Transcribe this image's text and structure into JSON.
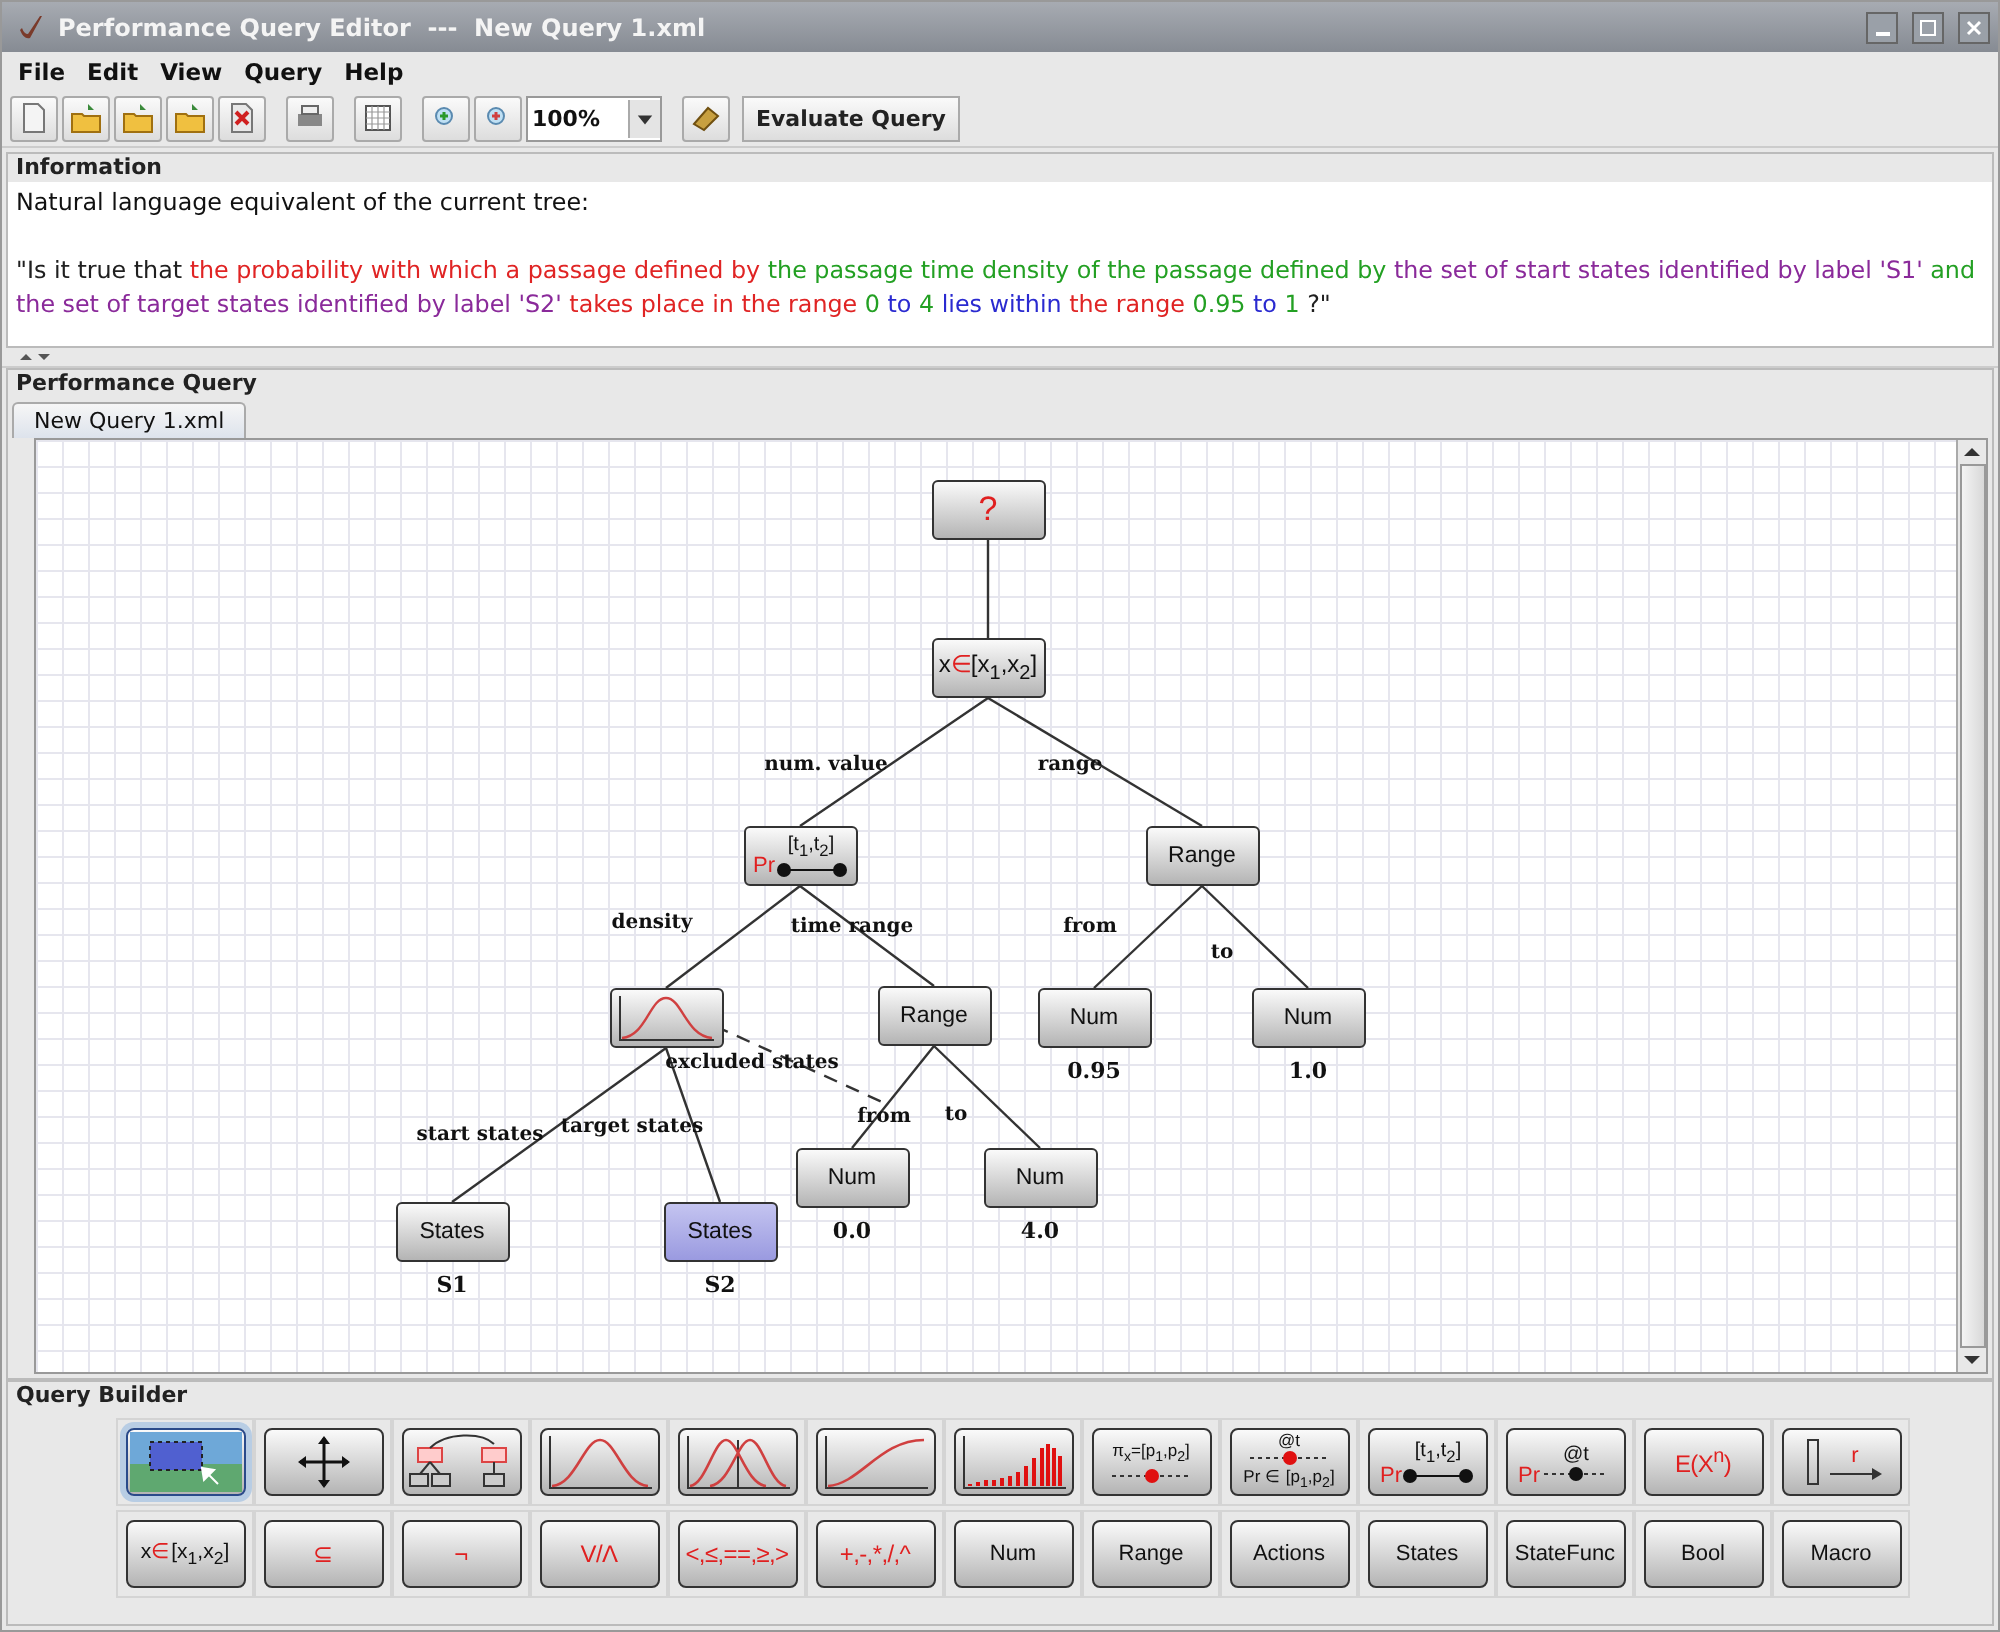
{
  "window": {
    "title": "Performance Query Editor  ---  New Query 1.xml"
  },
  "menu": [
    {
      "label": "File"
    },
    {
      "label": "Edit"
    },
    {
      "label": "View"
    },
    {
      "label": "Query"
    },
    {
      "label": "Help"
    }
  ],
  "toolbar": {
    "zoom": "100%",
    "evaluate": "Evaluate Query"
  },
  "information": {
    "title": "Information",
    "intro": "Natural language equivalent of the current tree:",
    "sentence": [
      {
        "text": "\"Is it true that ",
        "color": "#202020"
      },
      {
        "text": "the probability with which a passage defined by ",
        "color": "#e02424"
      },
      {
        "text": "the passage time density of the passage defined by ",
        "color": "#23a023"
      },
      {
        "text": "the set of start states identified by label 'S1' ",
        "color": "#8a2a9a"
      },
      {
        "text": "and ",
        "color": "#23a023"
      },
      {
        "text": "the set of target states identified by label 'S2' ",
        "color": "#8a2a9a"
      },
      {
        "text": "takes place in the range ",
        "color": "#e02424"
      },
      {
        "text": "0 ",
        "color": "#23a023"
      },
      {
        "text": "to ",
        "color": "#2a2ad0"
      },
      {
        "text": "4 ",
        "color": "#23a023"
      },
      {
        "text": "lies within ",
        "color": "#2a2ad0"
      },
      {
        "text": "the range ",
        "color": "#e02424"
      },
      {
        "text": "0.95 ",
        "color": "#23a023"
      },
      {
        "text": "to ",
        "color": "#2a2ad0"
      },
      {
        "text": "1 ",
        "color": "#23a023"
      },
      {
        "text": "?\"",
        "color": "#202020"
      }
    ]
  },
  "performance_query": {
    "title": "Performance Query",
    "tabs": [
      {
        "label": "New Query 1.xml",
        "selected": true
      }
    ],
    "tree": {
      "kind": "unknown",
      "label": "?",
      "selected": false,
      "children": [
        {
          "kind": "interval",
          "var": "x",
          "op": "∈",
          "range": "[x$_{1}$,x$_{2}$]",
          "selected": false,
          "children": [
            {
              "kind": "passage",
              "edge_label": "num. value",
              "prefix": "Pr",
              "label": "[t$_{1}$,t$_{2}$]",
              "selected": false,
              "children": [
                {
                  "kind": "density",
                  "edge_label": "density",
                  "excluded_label": "excluded states",
                  "selected": false,
                  "children": [
                    {
                      "kind": "plain",
                      "edge_label": "start states",
                      "label": "States",
                      "value": "S1",
                      "selected": false
                    },
                    {
                      "kind": "plain",
                      "edge_label": "target states",
                      "label": "States",
                      "value": "S2",
                      "selected": true
                    }
                  ]
                },
                {
                  "kind": "plain",
                  "edge_label": "time range",
                  "label": "Range",
                  "selected": false,
                  "children": [
                    {
                      "kind": "plain",
                      "edge_label": "from",
                      "label": "Num",
                      "value": "0.0",
                      "selected": false
                    },
                    {
                      "kind": "plain",
                      "edge_label": "to",
                      "label": "Num",
                      "value": "4.0",
                      "selected": false
                    }
                  ]
                }
              ]
            },
            {
              "kind": "plain",
              "edge_label": "range",
              "label": "Range",
              "selected": false,
              "children": [
                {
                  "kind": "plain",
                  "edge_label": "from",
                  "label": "Num",
                  "value": "0.95",
                  "selected": false
                },
                {
                  "kind": "plain",
                  "edge_label": "to",
                  "label": "Num",
                  "value": "1.0",
                  "selected": false
                }
              ]
            }
          ]
        }
      ]
    }
  },
  "query_builder": {
    "title": "Query Builder",
    "rows": [
      [
        {
          "kind": "select",
          "selected": true
        },
        {
          "kind": "move",
          "selected": false
        },
        {
          "kind": "transform",
          "selected": false
        },
        {
          "kind": "density",
          "selected": false
        },
        {
          "kind": "distributions",
          "selected": false
        },
        {
          "kind": "cdf",
          "selected": false
        },
        {
          "kind": "histogram",
          "selected": false
        },
        {
          "kind": "transient",
          "label": "π$_{x}$=[p$_{1}$,p$_{2}$]",
          "selected": false
        },
        {
          "kind": "transient_prob",
          "top": "@t",
          "bottom": "Pr ∈ [p$_{1}$,p$_{2}$]",
          "selected": false
        },
        {
          "kind": "passage",
          "prefix": "Pr",
          "label": "[t$_{1}$,t$_{2}$]",
          "selected": false
        },
        {
          "kind": "point_prob",
          "prefix": "Pr",
          "label": "@t",
          "selected": false
        },
        {
          "kind": "symbol",
          "label": "E(X$^{n}$)",
          "selected": false
        },
        {
          "kind": "reward",
          "label": "r",
          "selected": false
        }
      ],
      [
        {
          "kind": "interval",
          "var": "x",
          "op": "∈",
          "range": "[x$_{1}$,x$_{2}$]",
          "selected": false
        },
        {
          "kind": "symbol",
          "label": "⊆",
          "selected": false
        },
        {
          "kind": "symbol",
          "label": "¬",
          "selected": false
        },
        {
          "kind": "symbol",
          "label": "V/Λ",
          "selected": false
        },
        {
          "kind": "symbol",
          "label": "<,≤,==,≥,>",
          "selected": false
        },
        {
          "kind": "symbol",
          "label": "+,-,*,/,^",
          "selected": false
        },
        {
          "kind": "text",
          "label": "Num",
          "selected": false
        },
        {
          "kind": "text",
          "label": "Range",
          "selected": false
        },
        {
          "kind": "text",
          "label": "Actions",
          "selected": false
        },
        {
          "kind": "text",
          "label": "States",
          "selected": false
        },
        {
          "kind": "text",
          "label": "StateFunc",
          "selected": false
        },
        {
          "kind": "text",
          "label": "Bool",
          "selected": false
        },
        {
          "kind": "text",
          "label": "Macro",
          "selected": false
        }
      ]
    ]
  }
}
